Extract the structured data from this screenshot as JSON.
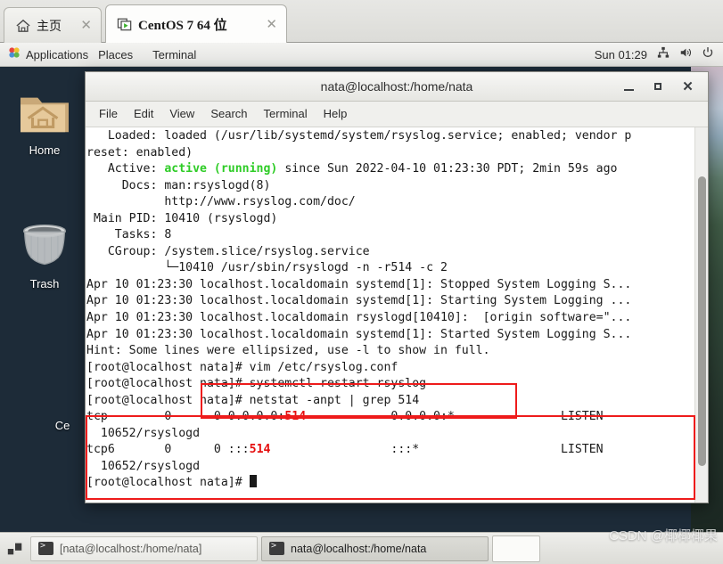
{
  "vm_tabs": [
    {
      "label": "主页",
      "icon": "home-icon",
      "close": "✕",
      "active": false
    },
    {
      "label": "CentOS 7 64 位",
      "icon": "vm-play-icon",
      "close": "✕",
      "active": true
    }
  ],
  "gnome_panel": {
    "applications": "Applications",
    "places": "Places",
    "terminal": "Terminal",
    "clock": "Sun 01:29",
    "icons": [
      "network-icon",
      "volume-icon",
      "power-icon"
    ]
  },
  "desktop": {
    "icons": [
      {
        "name": "home-folder",
        "label": "Home"
      },
      {
        "name": "trash",
        "label": "Trash"
      },
      {
        "name": "partial-icon",
        "label": "Ce"
      }
    ]
  },
  "terminal": {
    "title": "nata@localhost:/home/nata",
    "menus": [
      "File",
      "Edit",
      "View",
      "Search",
      "Terminal",
      "Help"
    ],
    "window_controls": {
      "minimize": "minimize-button",
      "maximize": "maximize-button",
      "close": "close-button"
    },
    "lines": [
      {
        "segments": [
          {
            "t": "   Loaded: loaded (/usr/lib/systemd/system/rsyslog.service; enabled; vendor p"
          }
        ]
      },
      {
        "segments": [
          {
            "t": "reset: enabled)"
          }
        ]
      },
      {
        "segments": [
          {
            "t": "   Active: "
          },
          {
            "t": "active (running)",
            "c": "green"
          },
          {
            "t": " since Sun 2022-04-10 01:23:30 PDT; 2min 59s ago"
          }
        ]
      },
      {
        "segments": [
          {
            "t": "     Docs: man:rsyslogd(8)"
          }
        ]
      },
      {
        "segments": [
          {
            "t": "           http://www.rsyslog.com/doc/"
          }
        ]
      },
      {
        "segments": [
          {
            "t": " Main PID: 10410 (rsyslogd)"
          }
        ]
      },
      {
        "segments": [
          {
            "t": "    Tasks: 8"
          }
        ]
      },
      {
        "segments": [
          {
            "t": "   CGroup: /system.slice/rsyslog.service"
          }
        ]
      },
      {
        "segments": [
          {
            "t": "           └─10410 /usr/sbin/rsyslogd -n -r514 -c 2"
          }
        ]
      },
      {
        "segments": [
          {
            "t": ""
          }
        ]
      },
      {
        "segments": [
          {
            "t": "Apr 10 01:23:30 localhost.localdomain systemd[1]: Stopped System Logging S..."
          }
        ]
      },
      {
        "segments": [
          {
            "t": "Apr 10 01:23:30 localhost.localdomain systemd[1]: Starting System Logging ..."
          }
        ]
      },
      {
        "segments": [
          {
            "t": "Apr 10 01:23:30 localhost.localdomain rsyslogd[10410]:  [origin software=\"..."
          }
        ]
      },
      {
        "segments": [
          {
            "t": "Apr 10 01:23:30 localhost.localdomain systemd[1]: Started System Logging S..."
          }
        ]
      },
      {
        "segments": [
          {
            "t": "Hint: Some lines were ellipsized, use -l to show in full."
          }
        ]
      },
      {
        "segments": [
          {
            "t": "[root@localhost nata]# vim /etc/rsyslog.conf"
          }
        ]
      },
      {
        "segments": [
          {
            "t": "[root@localhost nata]# systemctl restart rsyslog"
          }
        ]
      },
      {
        "segments": [
          {
            "t": "[root@localhost nata]# netstat -anpt | grep 514"
          }
        ]
      },
      {
        "segments": [
          {
            "t": "tcp        0      0 0.0.0.0:"
          },
          {
            "t": "514",
            "c": "red"
          },
          {
            "t": "            0.0.0.0:*               LISTEN"
          }
        ]
      },
      {
        "segments": [
          {
            "t": "  10652/rsyslogd"
          }
        ]
      },
      {
        "segments": [
          {
            "t": "tcp6       0      0 :::"
          },
          {
            "t": "514",
            "c": "red"
          },
          {
            "t": "                 :::*                    LISTEN"
          }
        ]
      },
      {
        "segments": [
          {
            "t": "  10652/rsyslogd"
          }
        ]
      },
      {
        "segments": [
          {
            "t": "[root@localhost nata]# ",
            "cursor": true
          }
        ]
      }
    ]
  },
  "annotations": {
    "color": "#ee1b1b",
    "boxes": [
      {
        "name": "commands-highlight"
      },
      {
        "name": "netstat-output-highlight"
      }
    ]
  },
  "taskbar": {
    "items": [
      {
        "label": "[nata@localhost:/home/nata]",
        "active": false
      },
      {
        "label": "nata@localhost:/home/nata",
        "active": true
      }
    ]
  },
  "watermark": "CSDN @椰椰椰果"
}
